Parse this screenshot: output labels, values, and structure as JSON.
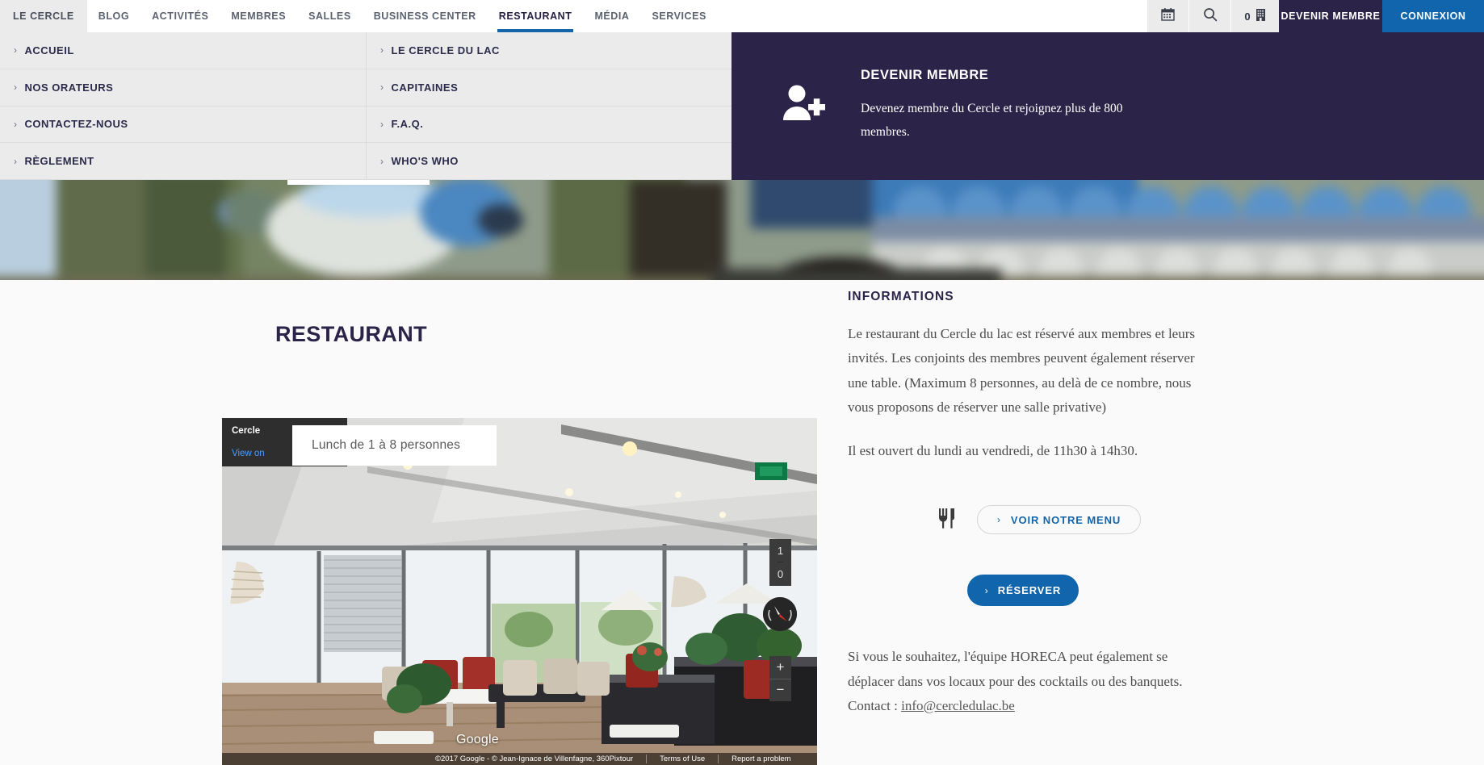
{
  "nav": {
    "items": [
      {
        "label": "LE CERCLE",
        "state": "first"
      },
      {
        "label": "BLOG",
        "state": "normal"
      },
      {
        "label": "ACTIVITÉS",
        "state": "normal"
      },
      {
        "label": "MEMBRES",
        "state": "normal"
      },
      {
        "label": "SALLES",
        "state": "normal"
      },
      {
        "label": "BUSINESS CENTER",
        "state": "normal"
      },
      {
        "label": "RESTAURANT",
        "state": "active"
      },
      {
        "label": "MÉDIA",
        "state": "normal"
      },
      {
        "label": "SERVICES",
        "state": "normal"
      }
    ],
    "calendar_icon": "calendar-icon",
    "search_icon": "search-icon",
    "cart_icon": "cart-icon",
    "cart_count": "0",
    "become_member": "DEVENIR MEMBRE",
    "login": "CONNEXION",
    "accent_blue": "#1165ac",
    "accent_purple": "#2b2348"
  },
  "dropdown": {
    "column_left": [
      {
        "label": "ACCUEIL"
      },
      {
        "label": "NOS ORATEURS"
      },
      {
        "label": "CONTACTEZ-NOUS"
      },
      {
        "label": "RÈGLEMENT"
      }
    ],
    "column_right": [
      {
        "label": "LE CERCLE DU LAC"
      },
      {
        "label": "CAPITAINES"
      },
      {
        "label": "F.A.Q."
      },
      {
        "label": "WHO'S WHO"
      }
    ],
    "chevron": "›",
    "promo": {
      "icon": "add-user-icon",
      "title": "DEVENIR MEMBRE",
      "body": "Devenez membre du Cercle et rejoignez plus de 800 membres."
    }
  },
  "page": {
    "title": "RESTAURANT"
  },
  "streetview": {
    "badge_title": "Cercle",
    "badge_link": "View on",
    "tooltip": "Lunch de 1 à 8 personnes",
    "fov_top": "1",
    "fov_bottom": "0",
    "zoom_in": "+",
    "zoom_out": "−",
    "google_logo": "Google",
    "attribution": "©2017 Google - © Jean-Ignace de Villenfagne, 360Pixtour",
    "terms": "Terms of Use",
    "report": "Report a problem",
    "compass_icon": "compass-icon"
  },
  "info": {
    "heading": "INFORMATIONS",
    "paragraph_1": "Le restaurant du Cercle du lac est réservé aux membres et leurs invités. Les conjoints des membres peuvent également réserver une table. (Maximum 8 personnes, au delà de ce nombre, nous vous proposons de réserver une salle privative)",
    "paragraph_2": "Il est ouvert du lundi au vendredi, de 11h30 à 14h30.",
    "fork_icon": "fork-knife-icon",
    "menu_button": "VOIR NOTRE MENU",
    "reserve_button": "RÉSERVER",
    "chevron": "›",
    "paragraph_3_before": "Si vous le souhaitez, l'équipe HORECA peut également se déplacer dans vos locaux pour des cocktails ou des banquets. Contact : ",
    "email": "info@cercledulac.be"
  }
}
